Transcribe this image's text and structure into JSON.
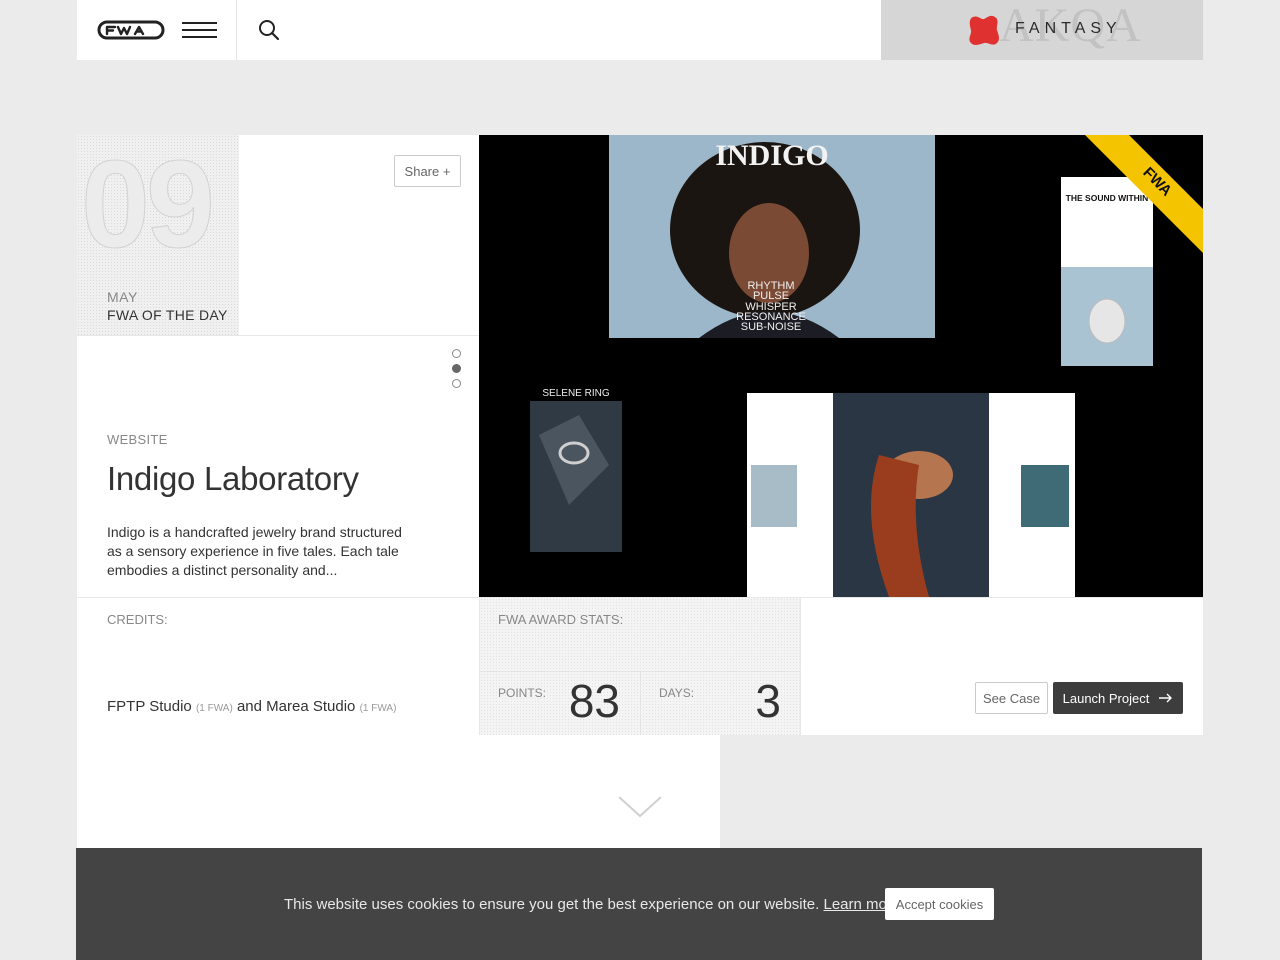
{
  "header": {
    "logo_text": "FWA",
    "sponsor": {
      "name": "FANTASY",
      "ghost_text": "AKQA"
    }
  },
  "award": {
    "day": "09",
    "month": "MAY",
    "label": "FWA OF THE DAY"
  },
  "share_label": "Share +",
  "slides": {
    "count": 3,
    "active_index": 1
  },
  "project": {
    "category": "WEBSITE",
    "title": "Indigo Laboratory",
    "description": "Indigo is a handcrafted jewelry brand structured as a sensory experience in five tales. Each tale embodies a distinct personality and..."
  },
  "hero_texts": {
    "brand": "INDIGO",
    "poem": [
      "RHYTHM",
      "PULSE",
      "WHISPER",
      "RESONANCE",
      "SUB-NOISE"
    ],
    "sound_within": "THE SOUND WITHIN",
    "selene": "SELENE RING",
    "ribbon": "FWA"
  },
  "credits": {
    "label": "CREDITS:",
    "studio_1": "FPTP Studio",
    "studio_1_count": "(1 FWA)",
    "joiner": "and",
    "studio_2": "Marea Studio",
    "studio_2_count": "(1 FWA)"
  },
  "stats": {
    "label": "FWA AWARD STATS:",
    "points_label": "POINTS:",
    "points": "83",
    "days_label": "DAYS:",
    "days": "3"
  },
  "actions": {
    "see_case": "See Case",
    "launch": "Launch Project"
  },
  "cookie": {
    "text": "This website uses cookies to ensure you get the best experience on our website.",
    "learn_more": "Learn more",
    "accept": "Accept cookies"
  },
  "colors": {
    "ribbon": "#f5c400",
    "sponsor_red": "#e03131",
    "hero_bg": "#000000"
  }
}
